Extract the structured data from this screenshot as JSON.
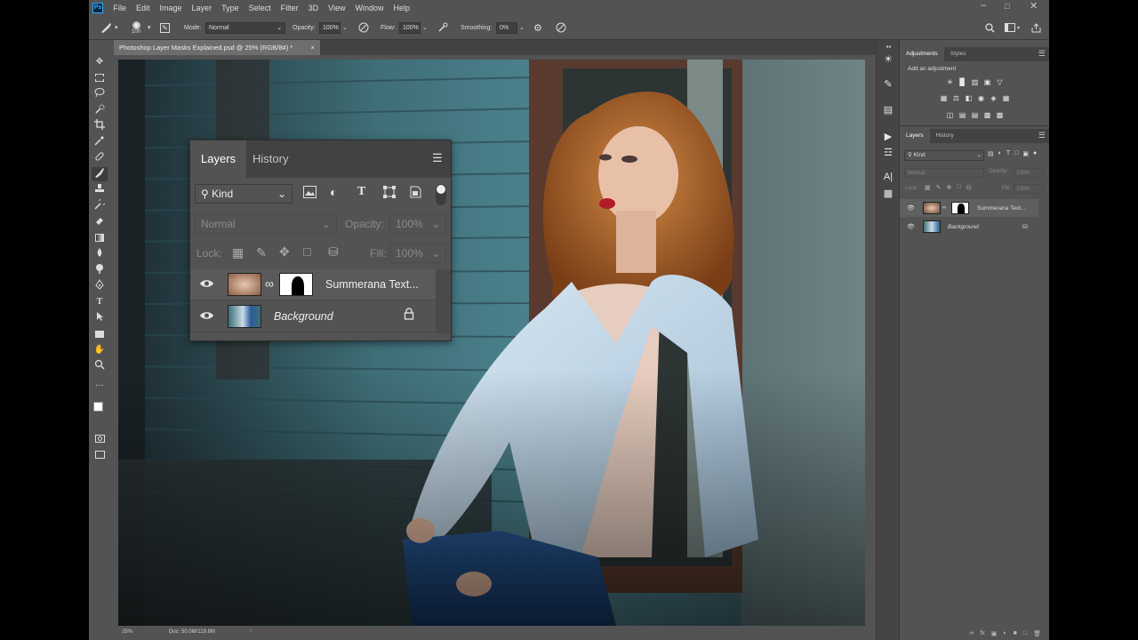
{
  "menubar": {
    "logo": "Ps",
    "items": [
      "File",
      "Edit",
      "Image",
      "Layer",
      "Type",
      "Select",
      "Filter",
      "3D",
      "View",
      "Window",
      "Help"
    ]
  },
  "options": {
    "brush_size": "100",
    "mode_label": "Mode:",
    "mode_value": "Normal",
    "opacity_label": "Opacity:",
    "opacity_value": "100%",
    "flow_label": "Flow:",
    "flow_value": "100%",
    "smoothing_label": "Smoothing:",
    "smoothing_value": "0%"
  },
  "document": {
    "tab_title": "Photoshop Layer Masks Explained.psd @ 25% (RGB/8#) *",
    "zoom": "25%",
    "doc_info": "Doc: 50.0M/119.8M"
  },
  "right_panel": {
    "adjustments_tab": "Adjustments",
    "styles_tab": "Styles",
    "add_adjustment": "Add an adjustment",
    "layers_tab": "Layers",
    "history_tab": "History",
    "kind_label": "Kind",
    "blend_mode": "Normal",
    "opacity_label": "Opacity:",
    "opacity_value": "100%",
    "lock_label": "Lock:",
    "fill_label": "Fill:",
    "fill_value": "100%",
    "layers": [
      {
        "name": "Summerana Text..."
      },
      {
        "name": "Background"
      }
    ]
  },
  "layers_panel": {
    "tab_layers": "Layers",
    "tab_history": "History",
    "kind_label": "Kind",
    "blend_mode": "Normal",
    "opacity_label": "Opacity:",
    "opacity_value": "100%",
    "lock_label": "Lock:",
    "fill_label": "Fill:",
    "fill_value": "100%",
    "layers": [
      {
        "name": "Summerana Text...",
        "visible": true
      },
      {
        "name": "Background",
        "visible": true,
        "locked": true
      }
    ]
  },
  "colors": {
    "ui_bg": "#535353",
    "panel_dark": "#424242",
    "canvas_wall": "#3e6e78",
    "accent": "#31a8ff"
  },
  "icons": [
    "move-icon",
    "marquee-icon",
    "lasso-icon",
    "quick-select-icon",
    "crop-icon",
    "eyedropper-icon",
    "healing-icon",
    "brush-icon",
    "stamp-icon",
    "history-brush-icon",
    "eraser-icon",
    "gradient-icon",
    "blur-icon",
    "dodge-icon",
    "pen-icon",
    "type-icon",
    "path-select-icon",
    "rectangle-icon",
    "hand-icon",
    "zoom-icon",
    "search-icon",
    "eye-icon",
    "lock-icon",
    "chain-icon"
  ]
}
